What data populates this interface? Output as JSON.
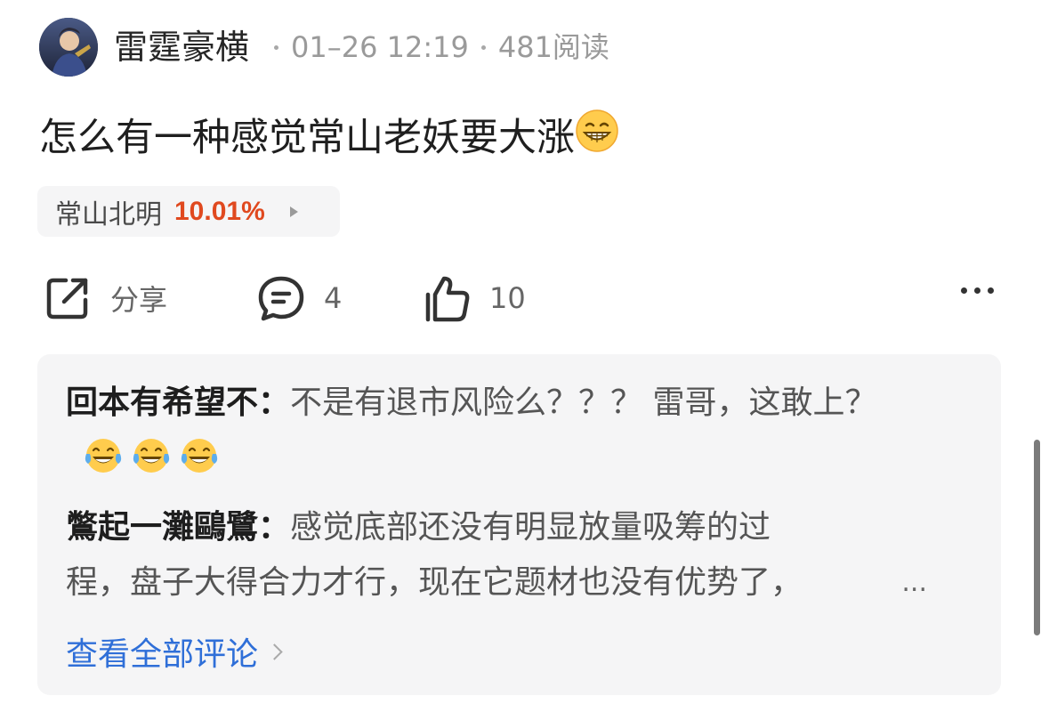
{
  "post": {
    "author": "雷霆豪横",
    "date": "01–26 12:19",
    "reads": "481阅读",
    "content": "怎么有一种感觉常山老妖要大涨",
    "emoji": "grinning-face"
  },
  "stock_tag": {
    "name": "常山北明",
    "change": "10.01%",
    "change_color": "#e0491f"
  },
  "actions": {
    "share_label": "分享",
    "comment_count": "4",
    "like_count": "10"
  },
  "comments": {
    "items": [
      {
        "user": "回本有希望不",
        "separator": "：",
        "text": "不是有退市风险么？？？ 雷哥，这敢上？",
        "emoji": [
          "tears-of-joy",
          "tears-of-joy",
          "tears-of-joy"
        ]
      },
      {
        "user": "鷩起一灘鷗鷺",
        "separator": "：",
        "text_line1": "感觉底部还没有明显放量吸筹的过",
        "text_line2": "程，盘子大得合力才行，现在它题材也没有优势了，",
        "truncation": "..."
      }
    ],
    "view_all_label": "查看全部评论"
  },
  "colors": {
    "link": "#2f6fd8",
    "muted": "#9a9a9a",
    "panel": "#f5f5f6"
  }
}
